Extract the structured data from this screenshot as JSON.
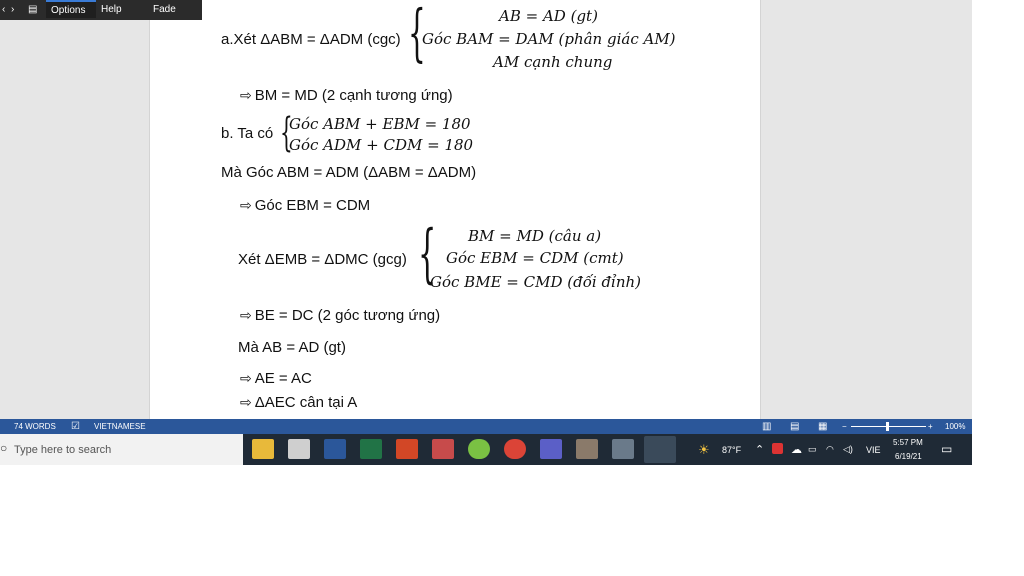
{
  "toolbar": {
    "items": [
      "Options",
      "Help",
      "Fade"
    ]
  },
  "doc": {
    "l1_label": "a.Xét ΔABM = ΔADM (cgc)",
    "l1_m1": "AB = AD (gt)",
    "l1_m2": "Góc BAM = DAM (phân giác AM)",
    "l1_m3": "AM cạnh chung",
    "l2": "BM = MD (2 cạnh tương ứng)",
    "l3_label": "b. Ta có",
    "l3_m1": "Góc ABM + EBM = 180",
    "l3_m2": "Góc ADM + CDM = 180",
    "l4": "Mà Góc ABM = ADM (ΔABM = ΔADM)",
    "l5": "Góc EBM = CDM",
    "l6_label": "Xét ΔEMB = ΔDMC (gcg)",
    "l6_m1": "BM = MD (câu a)",
    "l6_m2": "Góc EBM = CDM (cmt)",
    "l6_m3": "Góc BME = CMD (đối đỉnh)",
    "l7": "BE = DC (2 góc tương ứng)",
    "l8": "Mà AB = AD (gt)",
    "l9": "AE = AC",
    "l10": "ΔAEC cân tại A"
  },
  "status": {
    "words": "74 WORDS",
    "language": "VIETNAMESE",
    "zoom": "100%"
  },
  "taskbar": {
    "search_placeholder": "Type here to search",
    "weather": "87°F",
    "lang": "VIE",
    "time": "5:57 PM",
    "date": "6/19/21"
  }
}
